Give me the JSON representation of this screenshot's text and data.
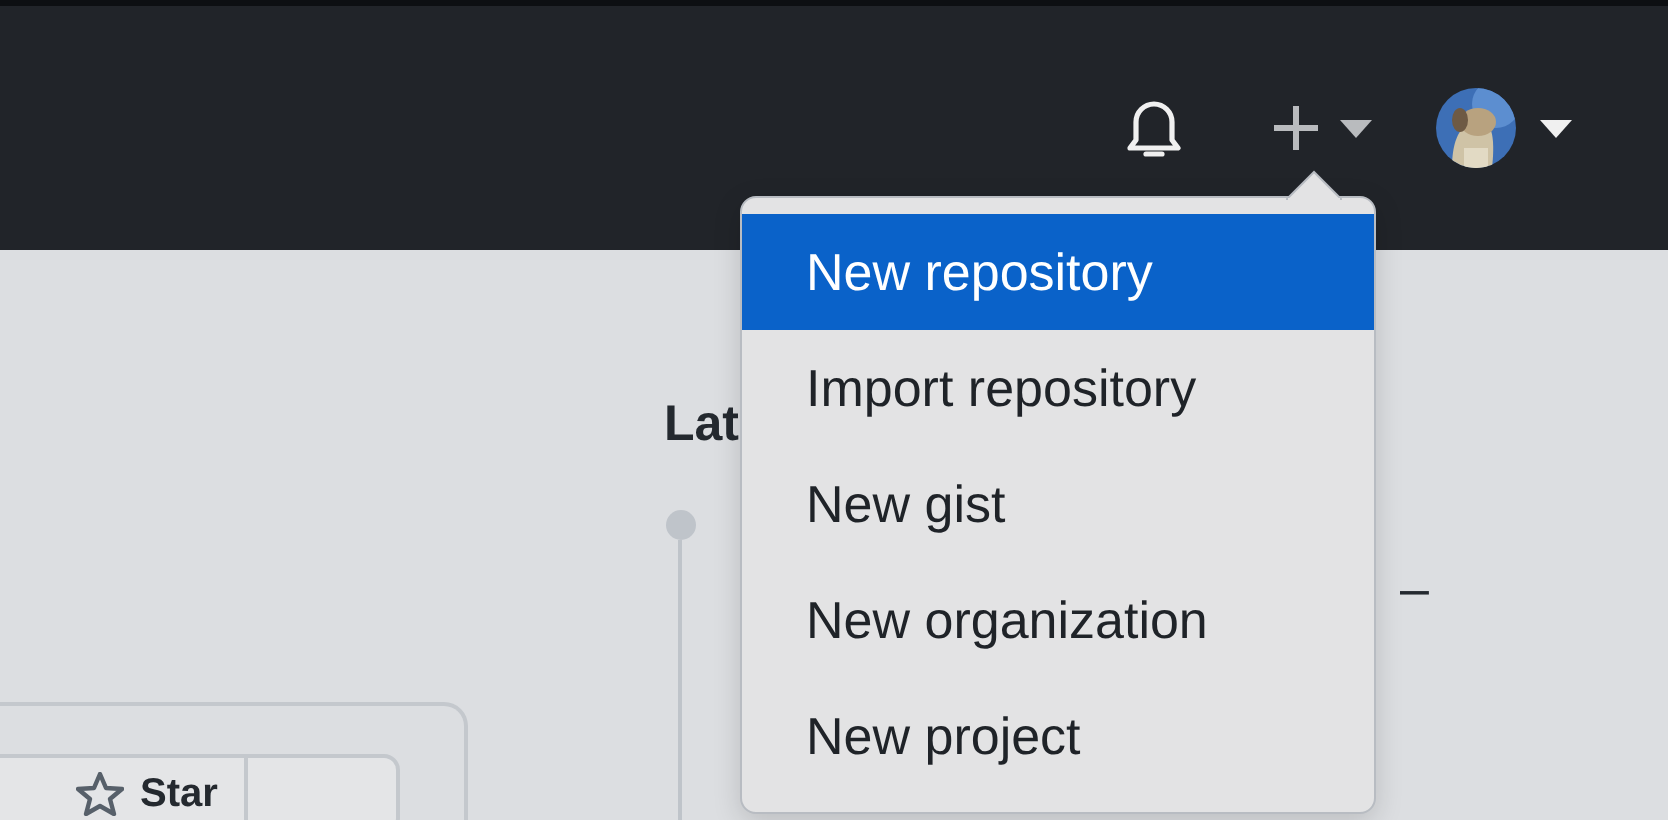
{
  "main": {
    "star_button": "Star",
    "latest_heading": "Lat",
    "release_dash": "–"
  },
  "create_menu": {
    "items": [
      {
        "label": "New repository",
        "selected": true
      },
      {
        "label": "Import repository",
        "selected": false
      },
      {
        "label": "New gist",
        "selected": false
      },
      {
        "label": "New organization",
        "selected": false
      },
      {
        "label": "New project",
        "selected": false
      }
    ]
  }
}
